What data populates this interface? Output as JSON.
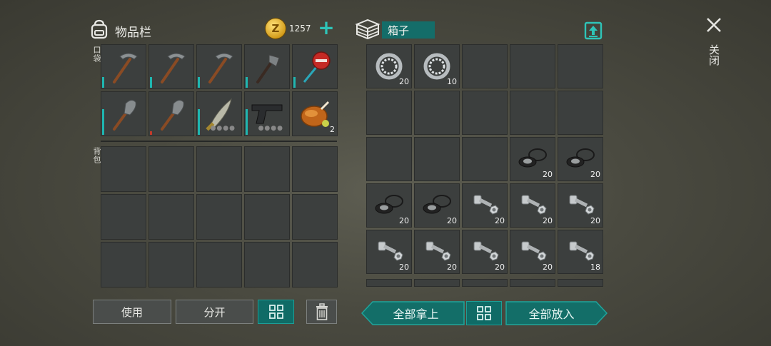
{
  "inventory": {
    "title": "物品栏",
    "coins": "1257",
    "pocket_label": "口袋",
    "backpack_label": "背包",
    "pocket": [
      {
        "icon": "pickaxe-icon",
        "durability": 0.25,
        "dur_color": "teal"
      },
      {
        "icon": "pickaxe-icon",
        "durability": 0.25,
        "dur_color": "teal"
      },
      {
        "icon": "pickaxe-icon",
        "durability": 0.25,
        "dur_color": "teal"
      },
      {
        "icon": "hatchet-icon",
        "durability": 0.25,
        "dur_color": "teal"
      },
      {
        "icon": "stop-sign-icon",
        "durability": 0.25,
        "dur_color": "teal"
      },
      {
        "icon": "shovel-icon",
        "durability": 0.6,
        "dur_color": "teal"
      },
      {
        "icon": "shovel-icon",
        "durability": 0.08,
        "dur_color": "red"
      },
      {
        "icon": "machete-icon",
        "durability": 0.6,
        "dur_color": "teal",
        "dots": true
      },
      {
        "icon": "pistol-icon",
        "durability": 0.6,
        "dur_color": "teal",
        "dots": true
      },
      {
        "icon": "roast-chicken-icon",
        "count": "2"
      }
    ],
    "buttons": {
      "use": "使用",
      "split": "分开"
    }
  },
  "box": {
    "title": "箱子",
    "slots": [
      {
        "icon": "bearing-icon",
        "count": "20"
      },
      {
        "icon": "bearing-icon",
        "count": "10"
      },
      {},
      {},
      {},
      {},
      {},
      {},
      {},
      {},
      {},
      {},
      {},
      {
        "icon": "gasket-icon",
        "count": "20"
      },
      {
        "icon": "gasket-icon",
        "count": "20"
      },
      {
        "icon": "gasket-icon",
        "count": "20"
      },
      {
        "icon": "gasket-icon",
        "count": "20"
      },
      {
        "icon": "bolt-nut-icon",
        "count": "20"
      },
      {
        "icon": "bolt-nut-icon",
        "count": "20"
      },
      {
        "icon": "bolt-nut-icon",
        "count": "20"
      },
      {
        "icon": "bolt-nut-icon",
        "count": "20"
      },
      {
        "icon": "bolt-nut-icon",
        "count": "20"
      },
      {
        "icon": "bolt-nut-icon",
        "count": "20"
      },
      {
        "icon": "bolt-nut-icon",
        "count": "20"
      },
      {
        "icon": "bolt-nut-icon",
        "count": "18"
      }
    ],
    "take_all": "全部拿上",
    "put_all": "全部放入"
  },
  "close_label": "关闭",
  "colors": {
    "accent": "#146d69",
    "teal": "#2ec4b8"
  }
}
